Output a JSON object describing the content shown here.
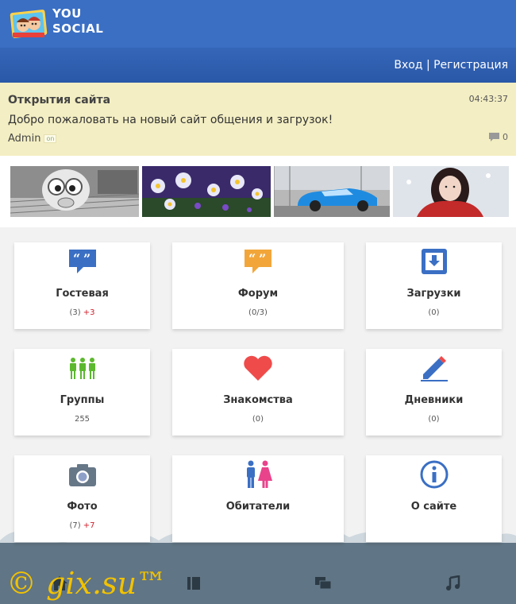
{
  "header": {
    "logo_line1": "YOU",
    "logo_line2": "SOCIAL",
    "login": "Вход",
    "separator": "|",
    "register": "Регистрация"
  },
  "news": {
    "title": "Открытия сайта",
    "time": "04:43:37",
    "text": "Добро пожаловать на новый сайт общения и загрузок!",
    "author": "Admin",
    "status": "on",
    "comments": "0"
  },
  "photos": [
    "cartoon-face-photo",
    "flowers-photo",
    "blue-car-photo",
    "girl-in-red-photo"
  ],
  "tiles": [
    {
      "label": "Гостевая",
      "count": "(3)",
      "plus": "+3",
      "icon": "quote-bubble-icon",
      "color": "#3a6fc4"
    },
    {
      "label": "Форум",
      "count": "(0/3)",
      "plus": "",
      "icon": "quote-bubble-icon",
      "color": "#f2a63a"
    },
    {
      "label": "Загрузки",
      "count": "(0)",
      "plus": "",
      "icon": "download-box-icon",
      "color": "#3a6fc4"
    },
    {
      "label": "Группы",
      "count": "255",
      "plus": "",
      "icon": "people-group-icon",
      "color": "#5cb82e"
    },
    {
      "label": "Знакомства",
      "count": "(0)",
      "plus": "",
      "icon": "heart-icon",
      "color": "#ef4b4b"
    },
    {
      "label": "Дневники",
      "count": "(0)",
      "plus": "",
      "icon": "pencil-icon",
      "color": "#3a6fc4"
    },
    {
      "label": "Фото",
      "count": "(7)",
      "plus": "+7",
      "icon": "camera-icon",
      "color": "#667788"
    },
    {
      "label": "Обитатели",
      "count": "",
      "plus": "",
      "icon": "man-woman-icon",
      "color": "#3a6fc4"
    },
    {
      "label": "О сайте",
      "count": "",
      "plus": "",
      "icon": "info-icon",
      "color": "#3a6fc4"
    }
  ],
  "footer": {
    "watermark": "© gix.su™",
    "icons": [
      "home-icon",
      "book-icon",
      "chat-icon",
      "music-icon"
    ]
  }
}
